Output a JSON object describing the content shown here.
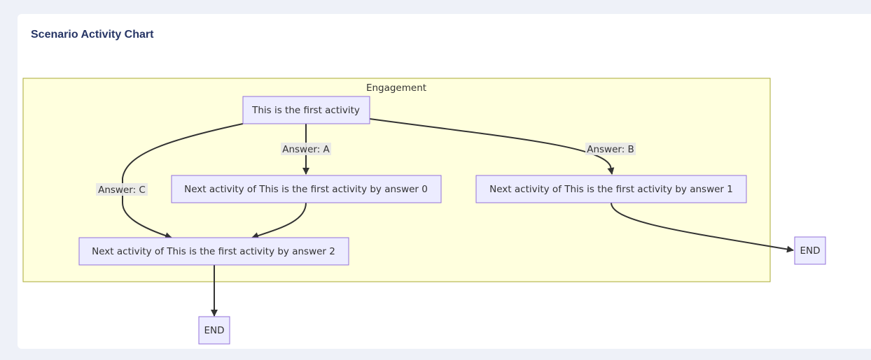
{
  "card": {
    "title": "Scenario Activity Chart"
  },
  "diagram": {
    "cluster": {
      "label": "Engagement"
    },
    "nodes": {
      "first": "This is the first activity",
      "next0": "Next activity of This is the first activity by answer 0",
      "next1": "Next activity of This is the first activity by answer 1",
      "next2": "Next activity of This is the first activity by answer 2",
      "end_right": "END",
      "end_bottom": "END"
    },
    "edge_labels": {
      "a": "Answer: A",
      "b": "Answer: B",
      "c": "Answer: C"
    }
  }
}
